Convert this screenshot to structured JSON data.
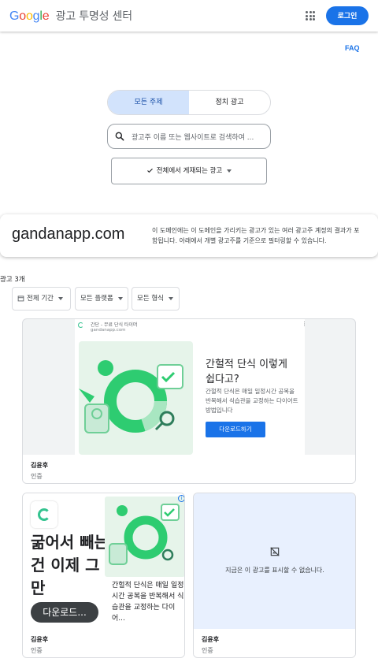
{
  "header": {
    "logo_letters": [
      "G",
      "o",
      "o",
      "g",
      "l",
      "e"
    ],
    "title": "광고 투명성 센터",
    "apps_icon": "apps-grid-icon",
    "login_label": "로그인"
  },
  "faq_label": "FAQ",
  "toggle": {
    "tabs": [
      "모든 주제",
      "정치 광고"
    ],
    "active_index": 0
  },
  "search": {
    "placeholder": "광고주 이름 또는 웹사이트로 검색하여 ...",
    "icon": "search-icon"
  },
  "region": {
    "label": "전체에서 게재되는 광고",
    "icon": "check-icon"
  },
  "domain": {
    "name": "gandanapp.com",
    "description": "이 도메인에는 이 도메인을 가리키는 광고가 있는 여러 광고주 계정의 결과가 포함됩니다. 아래에서 개별 광고주를 기준으로 필터링할 수 있습니다."
  },
  "results": {
    "count_label": "광고 3개"
  },
  "filters": [
    {
      "label": "전체 기간",
      "icon": "calendar-icon"
    },
    {
      "label": "모든 플랫폼"
    },
    {
      "label": "모든 형식"
    }
  ],
  "ads": [
    {
      "advertiser_name": "간단 - 무료 단식 타이머",
      "advertiser_url": "gandanapp.com",
      "headline": "간헐적 단식 이렇게 쉽다고?",
      "body": "간헐적 단식은 매일 일정시간 공복을 반복해서 식습관을 교정하는 다이어트 방법입니다",
      "cta": "다운로드하기",
      "footer_name": "김윤후",
      "footer_status": "인증"
    },
    {
      "big_text": "굶어서 빼는건 이제 그만",
      "cta": "다운로드...",
      "body": "간헐적 단식은 매일 일정시간 공복을 반복해서 식습관을 교정하는 다이어...",
      "footer_name": "김윤후",
      "footer_status": "인증"
    },
    {
      "unavailable_message": "지금은 이 광고를 표시할 수 없습니다.",
      "footer_name": "김윤후",
      "footer_status": "인증"
    }
  ],
  "colors": {
    "accent": "#1a73e8",
    "brand_green": "#34c38f",
    "toggle_active_bg": "#d2e3fc",
    "unavailable_bg": "#e8f0fe"
  }
}
